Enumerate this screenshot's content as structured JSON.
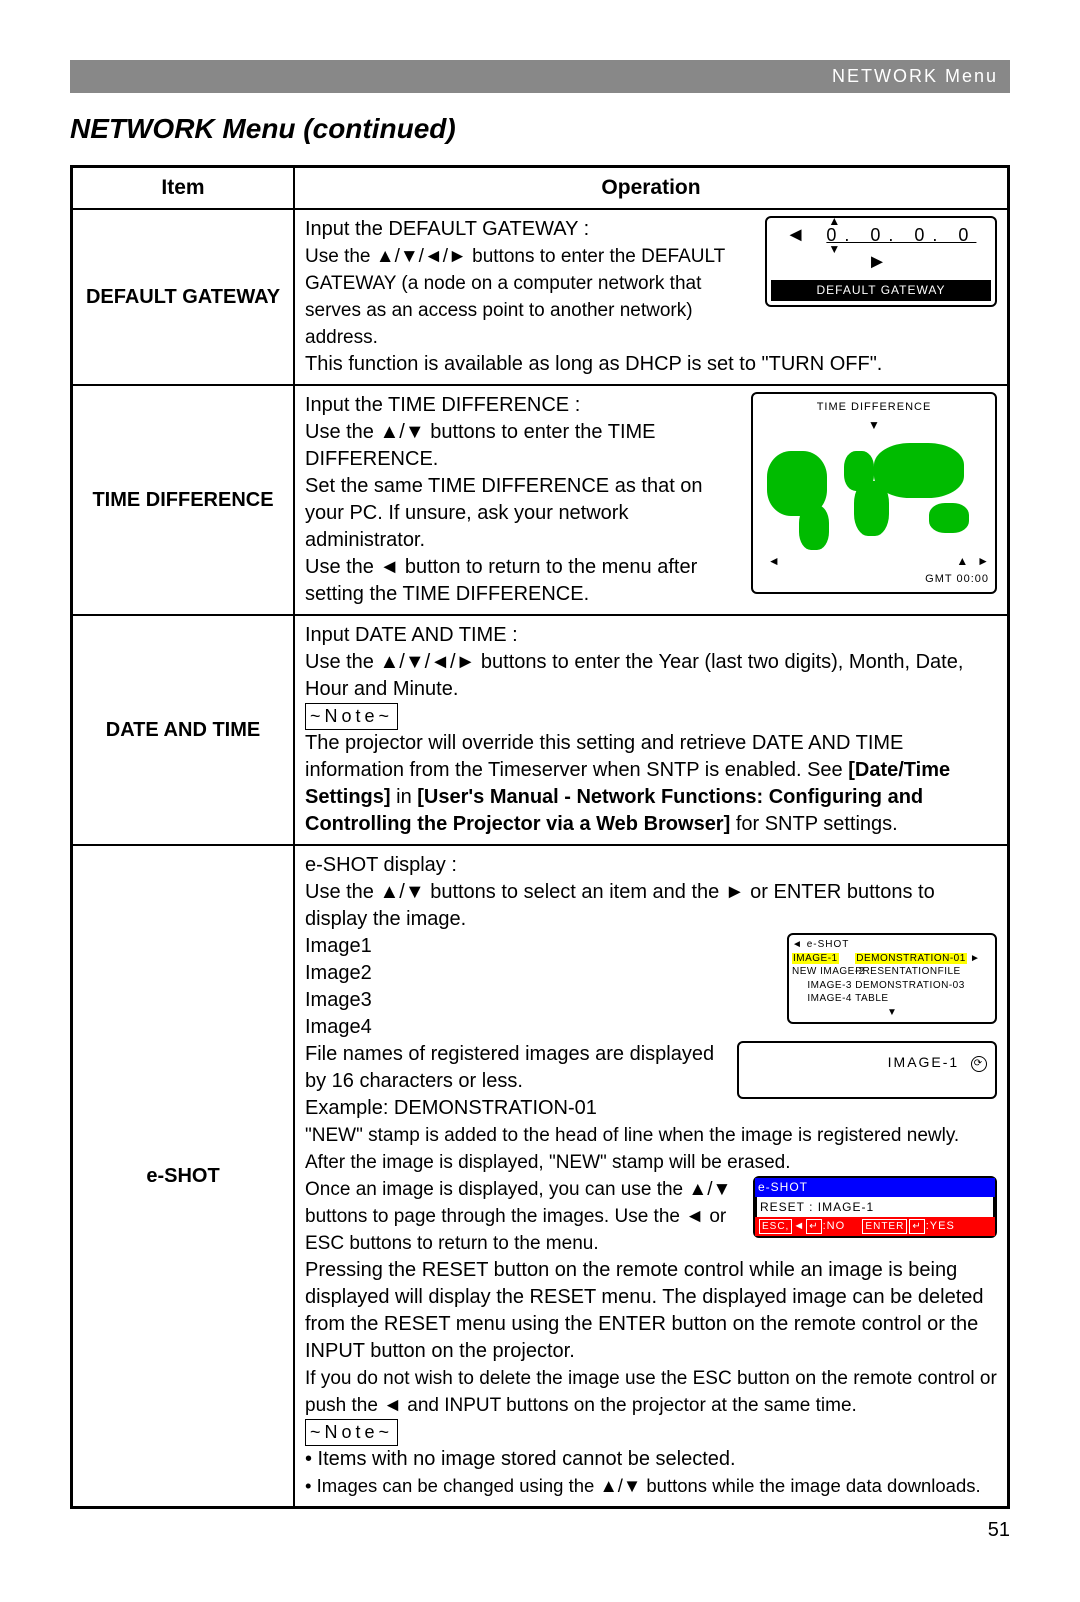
{
  "header": {
    "breadcrumb": "NETWORK Menu"
  },
  "title": "NETWORK Menu (continued)",
  "table": {
    "head_item": "Item",
    "head_operation": "Operation",
    "rows": [
      {
        "item": "DEFAULT GATEWAY",
        "op_line1": "Input the DEFAULT GATEWAY :",
        "op_line2a": "Use the ",
        "op_line2b": " buttons to enter the DEFAULT GATEWAY (a node on a computer network that serves as an access point to another network) address.",
        "op_line3": "This function is available as long as DHCP is set to \"TURN OFF\".",
        "ill_ip": "0. 0. 0. 0",
        "ill_label": "DEFAULT GATEWAY"
      },
      {
        "item": "TIME DIFFERENCE",
        "op_line1": "Input the TIME DIFFERENCE :",
        "op_line2a": "Use the ",
        "op_line2b": " buttons to enter the TIME DIFFERENCE.",
        "op_line3": "Set the same TIME DIFFERENCE as that on your PC. If unsure, ask your network administrator.",
        "op_line4a": "Use the ",
        "op_line4b": " button to return to the menu after setting the TIME DIFFERENCE.",
        "ill_title": "TIME DIFFERENCE",
        "ill_gmt": "GMT 00:00"
      },
      {
        "item": "DATE AND TIME",
        "op_line1": "Input DATE AND TIME :",
        "op_line2a": "Use the ",
        "op_line2b": " buttons to enter the Year (last two digits), Month, Date, Hour and Minute.",
        "note": "~Note~",
        "op_line3": "The projector will override this setting and retrieve  DATE AND TIME information from the Timeserver when SNTP is enabled. See ",
        "bold1": "[Date/Time Settings]",
        "mid1": " in ",
        "bold2": "[User's Manual - Network Functions: Configuring and Controlling the Projector via a Web Browser]",
        "end1": " for SNTP settings."
      },
      {
        "item": "e-SHOT",
        "op_line1": "e-SHOT display :",
        "op_line2a": "Use the ",
        "op_line2b": " buttons to select an item and the ",
        "op_line2c": " or ENTER buttons to display the image.",
        "images": [
          "Image1",
          "Image2",
          "Image3",
          "Image4"
        ],
        "op_line3": "File names of registered images are displayed by 16 characters or less.",
        "op_line4": "Example: DEMONSTRATION-01",
        "op_line5": "\"NEW\" stamp is added to the head of line when the image is registered newly. After the image is displayed, \"NEW\" stamp will be erased.",
        "op_line6a": "Once an image is displayed, you can use the ",
        "op_line6b": " buttons to page through the images. Use the ",
        "op_line6c": " or ESC buttons to return to the menu.",
        "op_line7": "Pressing the RESET button on the remote control while an image is being displayed will display the RESET menu. The displayed image can be deleted from the RESET menu using the ENTER button on the remote control or the INPUT button on the projector.",
        "op_line8a": "If you do not wish to delete the image use the ESC button on the remote control or push the ",
        "op_line8b": " and INPUT buttons on the projector at the same time.",
        "note": "~Note~",
        "bullet1": "• Items with no image stored cannot be selected.",
        "bullet2a": "• Images can be changed using the ",
        "bullet2b": " buttons while the image data downloads.",
        "ill_list": {
          "hdr": "e-SHOT",
          "rows": [
            {
              "c1": "IMAGE-1",
              "c2": "DEMONSTRATION-01",
              "sel": true
            },
            {
              "c1": "NEW IMAGE-2",
              "c2": "PRESENTATIONFILE"
            },
            {
              "c1": "IMAGE-3",
              "c2": "DEMONSTRATION-03"
            },
            {
              "c1": "IMAGE-4",
              "c2": "TABLE"
            }
          ]
        },
        "ill_image1": "IMAGE-1",
        "ill_reset": {
          "bar": "e-SHOT",
          "line": "RESET : IMAGE-1",
          "esc": "ESC,",
          "no": ":NO",
          "enter": "ENTER",
          "yes": ":YES"
        }
      }
    ]
  },
  "page_number": "51"
}
